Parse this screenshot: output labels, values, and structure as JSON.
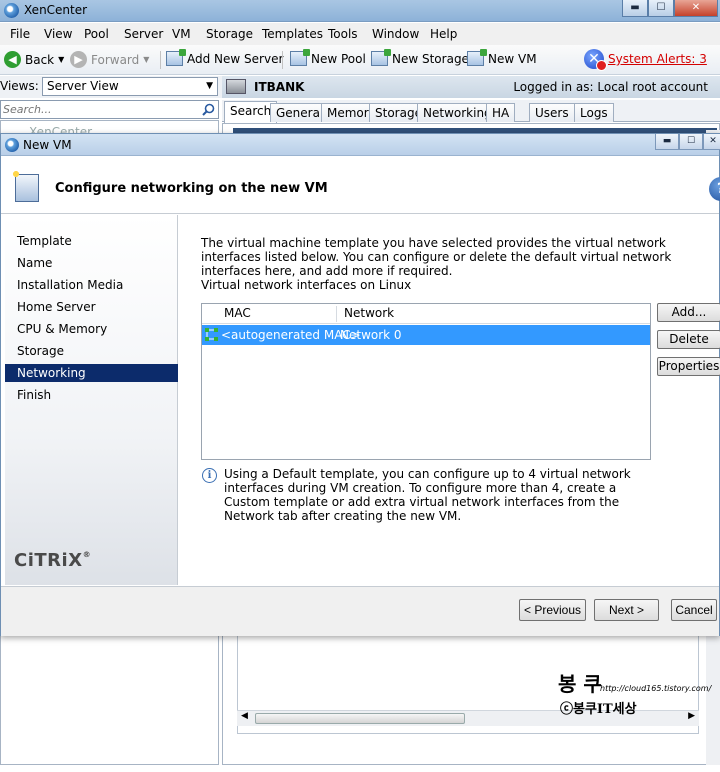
{
  "main_window": {
    "title": "XenCenter",
    "min_glyph": "▬",
    "max_glyph": "☐",
    "close_glyph": "✕"
  },
  "menu": [
    "File",
    "View",
    "Pool",
    "Server",
    "VM",
    "Storage",
    "Templates",
    "Tools",
    "Window",
    "Help"
  ],
  "toolbar": {
    "back_label": "Back",
    "forward_label": "Forward",
    "add_server_label": "Add New Server",
    "new_pool_label": "New Pool",
    "new_storage_label": "New Storage",
    "new_vm_label": "New VM",
    "alerts_label": "System Alerts: 3"
  },
  "left_panel": {
    "views_label": "Views:",
    "views_value": "Server View",
    "search_placeholder": "Search...",
    "tree_root": "XenCenter"
  },
  "server_header": {
    "name": "ITBANK",
    "logged_in": "Logged in as: Local root account"
  },
  "tabs": [
    "Search",
    "General",
    "Memory",
    "Storage",
    "Networking",
    "HA",
    "Users",
    "Logs"
  ],
  "watermark": {
    "line1": "봉 쿠",
    "line2": "http://cloud165.tistory.com/",
    "line3": "ⓒ봉쿠IT세상"
  },
  "dialog": {
    "title": "New VM",
    "header_title": "Configure networking on the new VM",
    "help_glyph": "?",
    "nav_items": [
      "Template",
      "Name",
      "Installation Media",
      "Home Server",
      "CPU & Memory",
      "Storage",
      "Networking",
      "Finish"
    ],
    "active_nav": "Networking",
    "brand": "CiTRiX",
    "brand_tm": "®",
    "intro": "The virtual machine template you have selected provides the virtual network interfaces listed below. You can configure or delete the default virtual network interfaces here, and add more if required.",
    "vif_label": "Virtual network interfaces on Linux",
    "table": {
      "columns": [
        "MAC",
        "Network"
      ],
      "rows": [
        {
          "mac": "<autogenerated MAC>",
          "network": "Network 0",
          "selected": true
        }
      ]
    },
    "buttons": {
      "add": "Add...",
      "delete": "Delete",
      "properties": "Properties",
      "previous": "< Previous",
      "next": "Next >",
      "cancel": "Cancel"
    },
    "info_glyph": "i",
    "info_text": "Using a Default template, you can configure up to 4 virtual network interfaces during VM creation. To configure more than 4, create a Custom template or add extra virtual network interfaces from the Network tab after creating the new VM."
  },
  "colors": {
    "selection": "#3399ff",
    "nav_active": "#0c2b6b",
    "alert": "#d40000"
  }
}
